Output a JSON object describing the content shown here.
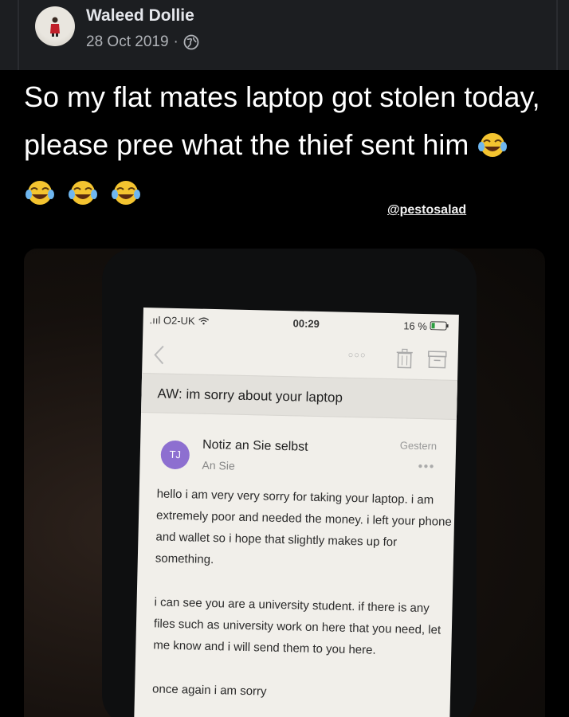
{
  "post": {
    "author": "Waleed Dollie",
    "date": "28 Oct 2019",
    "separator": "·",
    "text": "So my flat mates laptop got stolen today, please pree what the thief sent him",
    "emoji_count": 4,
    "watermark": "@pestosalad"
  },
  "phone": {
    "carrier": "O2-UK",
    "time": "00:29",
    "battery": "16 %",
    "subject": "AW: im sorry about your laptop",
    "avatar_initials": "TJ",
    "sender": "Notiz an Sie selbst",
    "recipient": "An Sie",
    "received": "Gestern",
    "body": [
      "hello i am very very sorry for taking your laptop. i am extremely poor and needed the money. i left your phone and wallet so i hope that slightly makes up for something.",
      "i can see you are a university student. if there is any files such as university work on here that you need, let me know and i will send them to you here.",
      "once again i am sorry"
    ]
  },
  "icons": {
    "globe": "globe-icon",
    "emoji": "tears-of-joy-emoji",
    "back": "chevron-left-icon",
    "trash": "trash-icon",
    "archive": "archive-icon"
  },
  "colors": {
    "header_bg": "#1c1e21",
    "avatar_purple": "#8d6fd0"
  }
}
